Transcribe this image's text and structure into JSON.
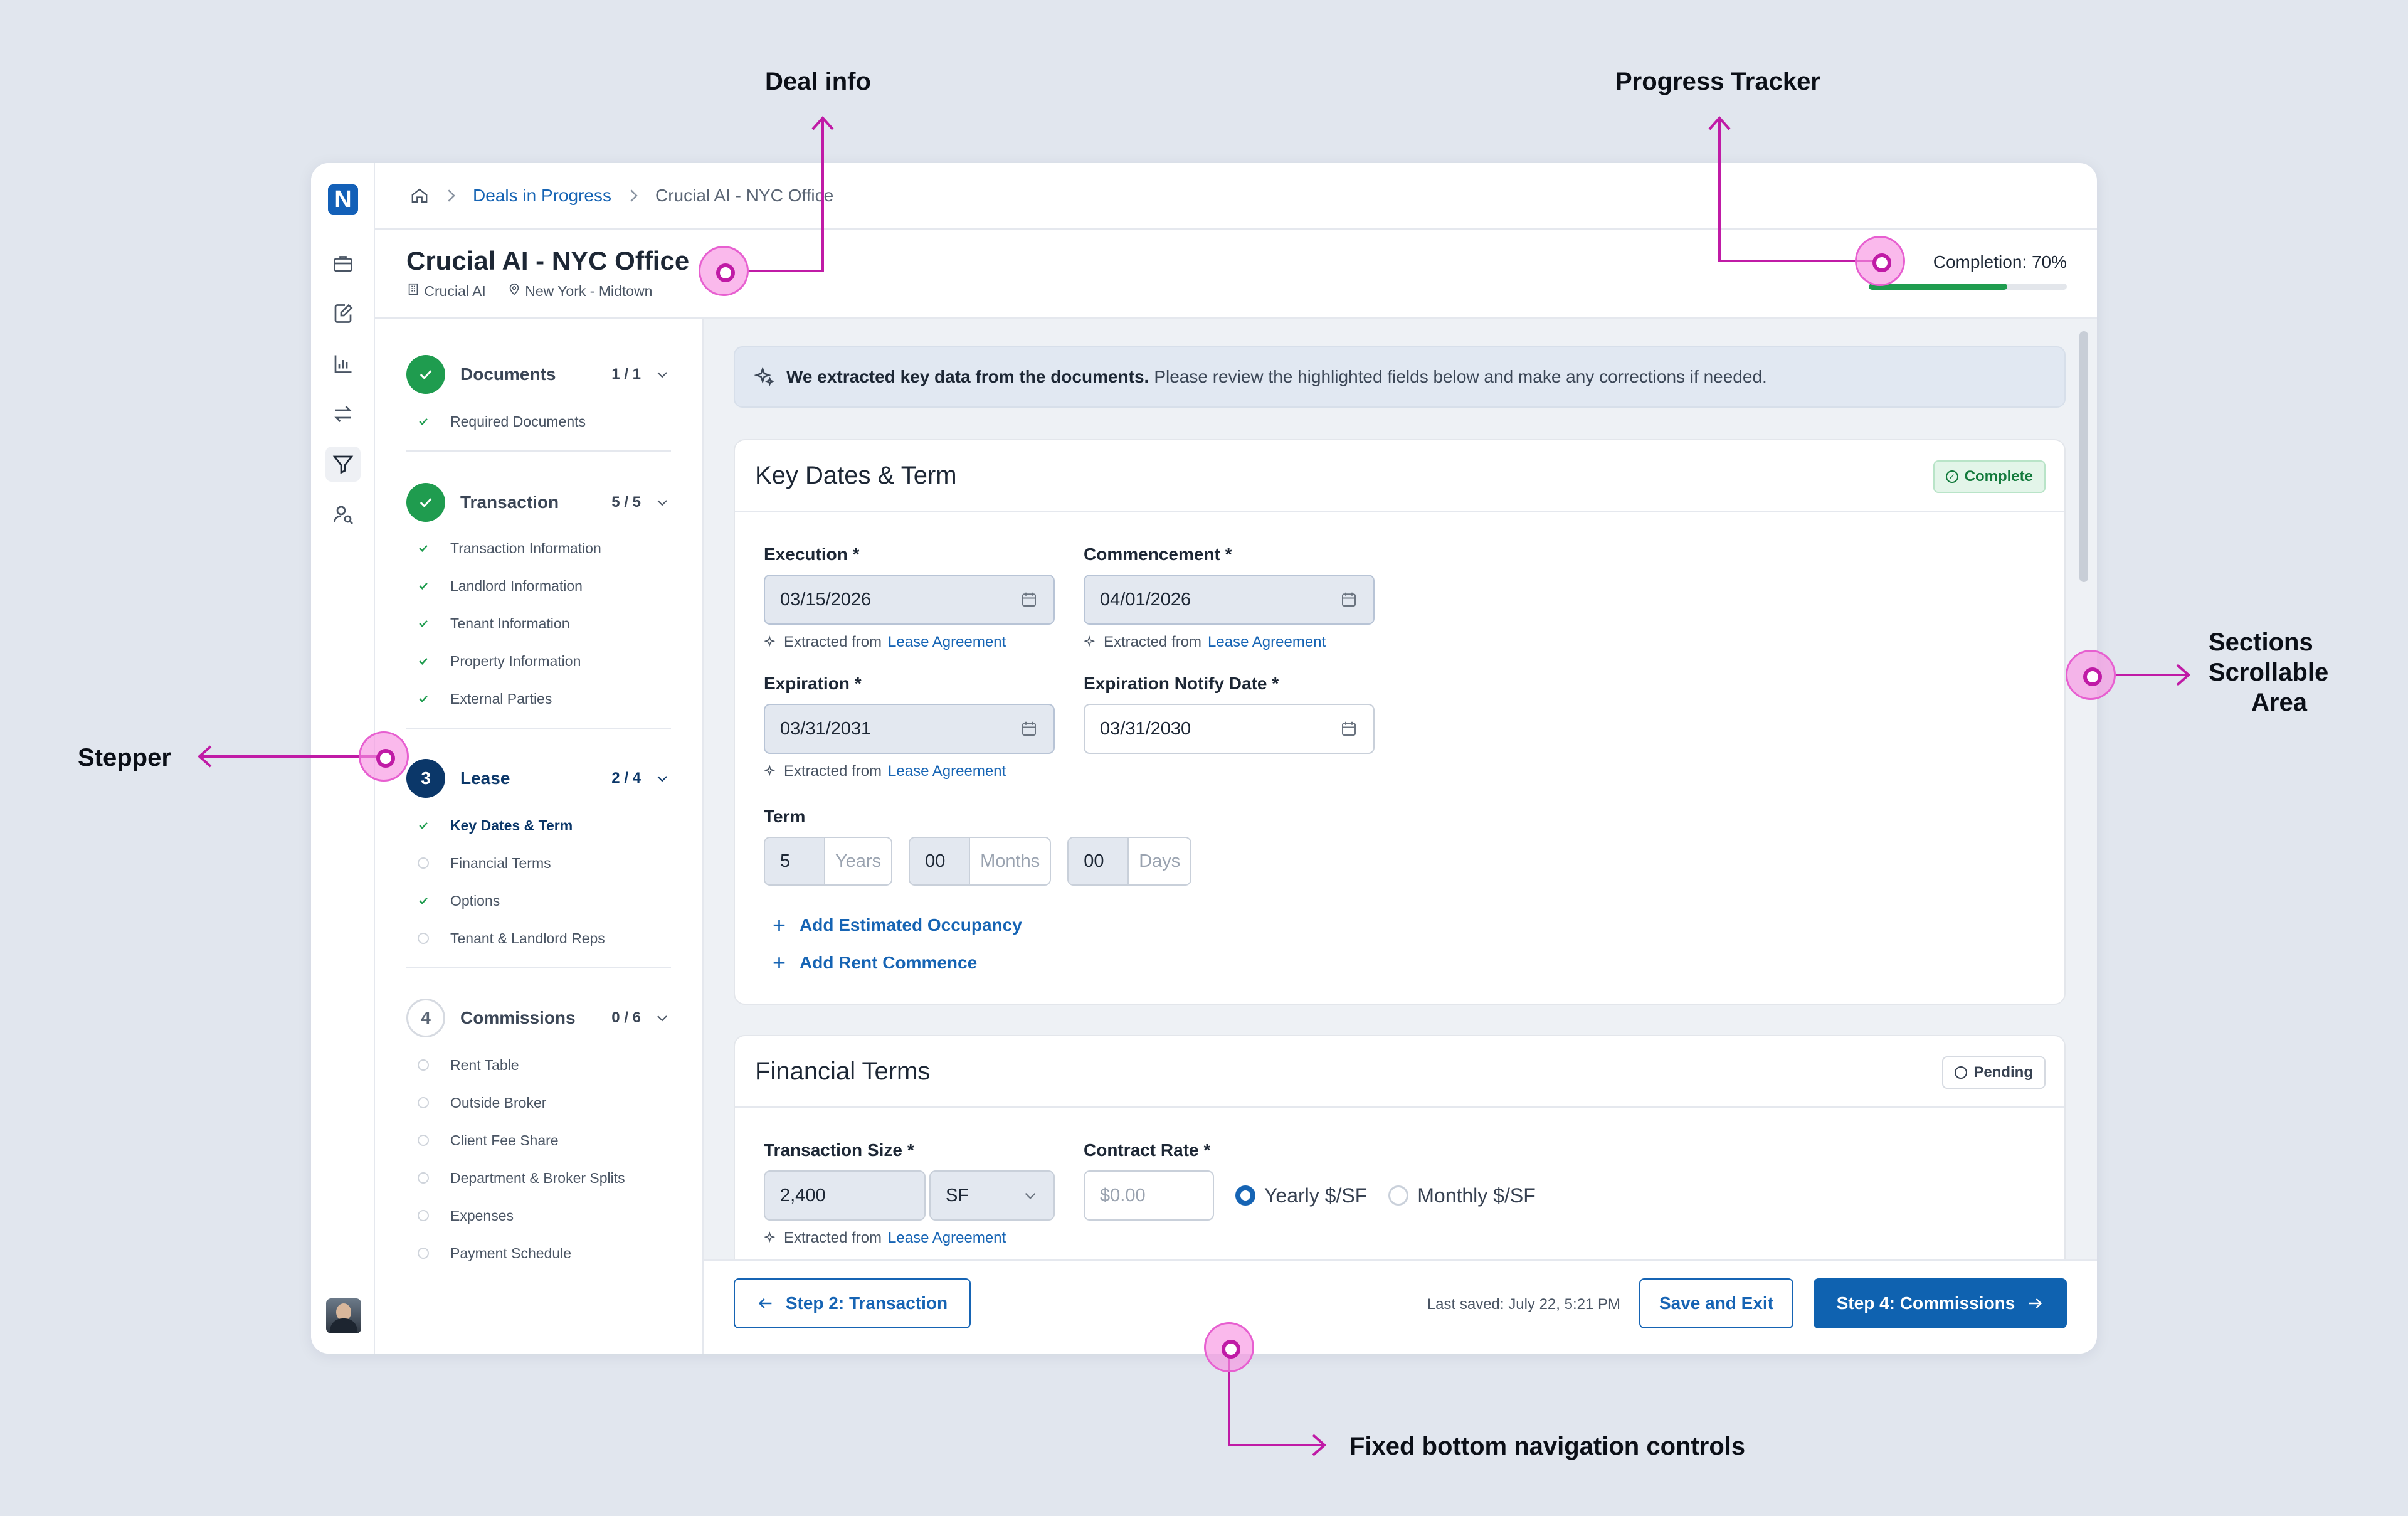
{
  "annotations": {
    "deal_info": "Deal info",
    "progress_tracker": "Progress Tracker",
    "stepper": "Stepper",
    "sections_line1": "Sections",
    "sections_line2": "Scrollable",
    "sections_line3": "Area",
    "bottom_nav": "Fixed bottom navigation controls"
  },
  "app": {
    "logo": "N",
    "nav_icons": [
      "briefcase-icon",
      "edit-document-icon",
      "bar-chart-icon",
      "transfer-arrows-icon",
      "filter-icon",
      "user-search-icon"
    ]
  },
  "breadcrumb": {
    "items": [
      "Deals in Progress",
      "Crucial AI - NYC Office"
    ]
  },
  "deal": {
    "title": "Crucial AI - NYC Office",
    "company": "Crucial AI",
    "location": "New York - Midtown",
    "completion_label": "Completion: 70%",
    "completion_value": 0.7
  },
  "stepper": {
    "steps": [
      {
        "number": "",
        "title": "Documents",
        "count": "1 / 1",
        "substeps": [
          "Required Documents"
        ]
      },
      {
        "number": "",
        "title": "Transaction",
        "count": "5 / 5",
        "substeps": [
          "Transaction Information",
          "Landlord Information",
          "Tenant Information",
          "Property Information",
          "External Parties"
        ]
      },
      {
        "number": "3",
        "title": "Lease",
        "count": "2 / 4",
        "substeps": [
          "Key Dates & Term",
          "Financial Terms",
          "Options",
          "Tenant & Landlord Reps"
        ]
      },
      {
        "number": "4",
        "title": "Commissions",
        "count": "0 / 6",
        "substeps": [
          "Rent Table",
          "Outside Broker",
          "Client Fee Share",
          "Department & Broker Splits",
          "Expenses",
          "Payment Schedule"
        ]
      }
    ]
  },
  "banner": {
    "bold": "We extracted key data from the documents.",
    "rest": "Please review the highlighted fields below and make any corrections if needed."
  },
  "key_dates": {
    "title": "Key Dates & Term",
    "badge": "Complete",
    "execution_label": "Execution *",
    "execution_value": "03/15/2026",
    "commencement_label": "Commencement *",
    "commencement_value": "04/01/2026",
    "expiration_label": "Expiration *",
    "expiration_value": "03/31/2031",
    "notify_label": "Expiration Notify Date *",
    "notify_value": "03/31/2030",
    "extracted_prefix": "Extracted from",
    "extracted_source": "Lease Agreement",
    "term_label": "Term",
    "years_value": "5",
    "years_unit": "Years",
    "months_value": "00",
    "months_unit": "Months",
    "days_value": "00",
    "days_unit": "Days",
    "add_occupancy": "Add Estimated Occupancy",
    "add_rent": "Add Rent Commence"
  },
  "financial": {
    "title": "Financial Terms",
    "badge": "Pending",
    "size_label": "Transaction Size *",
    "size_value": "2,400",
    "size_unit": "SF",
    "rate_label": "Contract Rate *",
    "rate_placeholder": "$0.00",
    "radio_yearly": "Yearly $/SF",
    "radio_monthly": "Monthly $/SF",
    "extracted_prefix": "Extracted from",
    "extracted_source": "Lease Agreement"
  },
  "footer": {
    "back_button": "Step 2: Transaction",
    "last_saved": "Last saved: July 22, 5:21 PM",
    "save_exit": "Save and Exit",
    "next_button": "Step 4: Commissions"
  },
  "colors": {
    "primary": "#0f62b0",
    "success": "#1f9c4f",
    "annotation": "#c01ba6"
  }
}
